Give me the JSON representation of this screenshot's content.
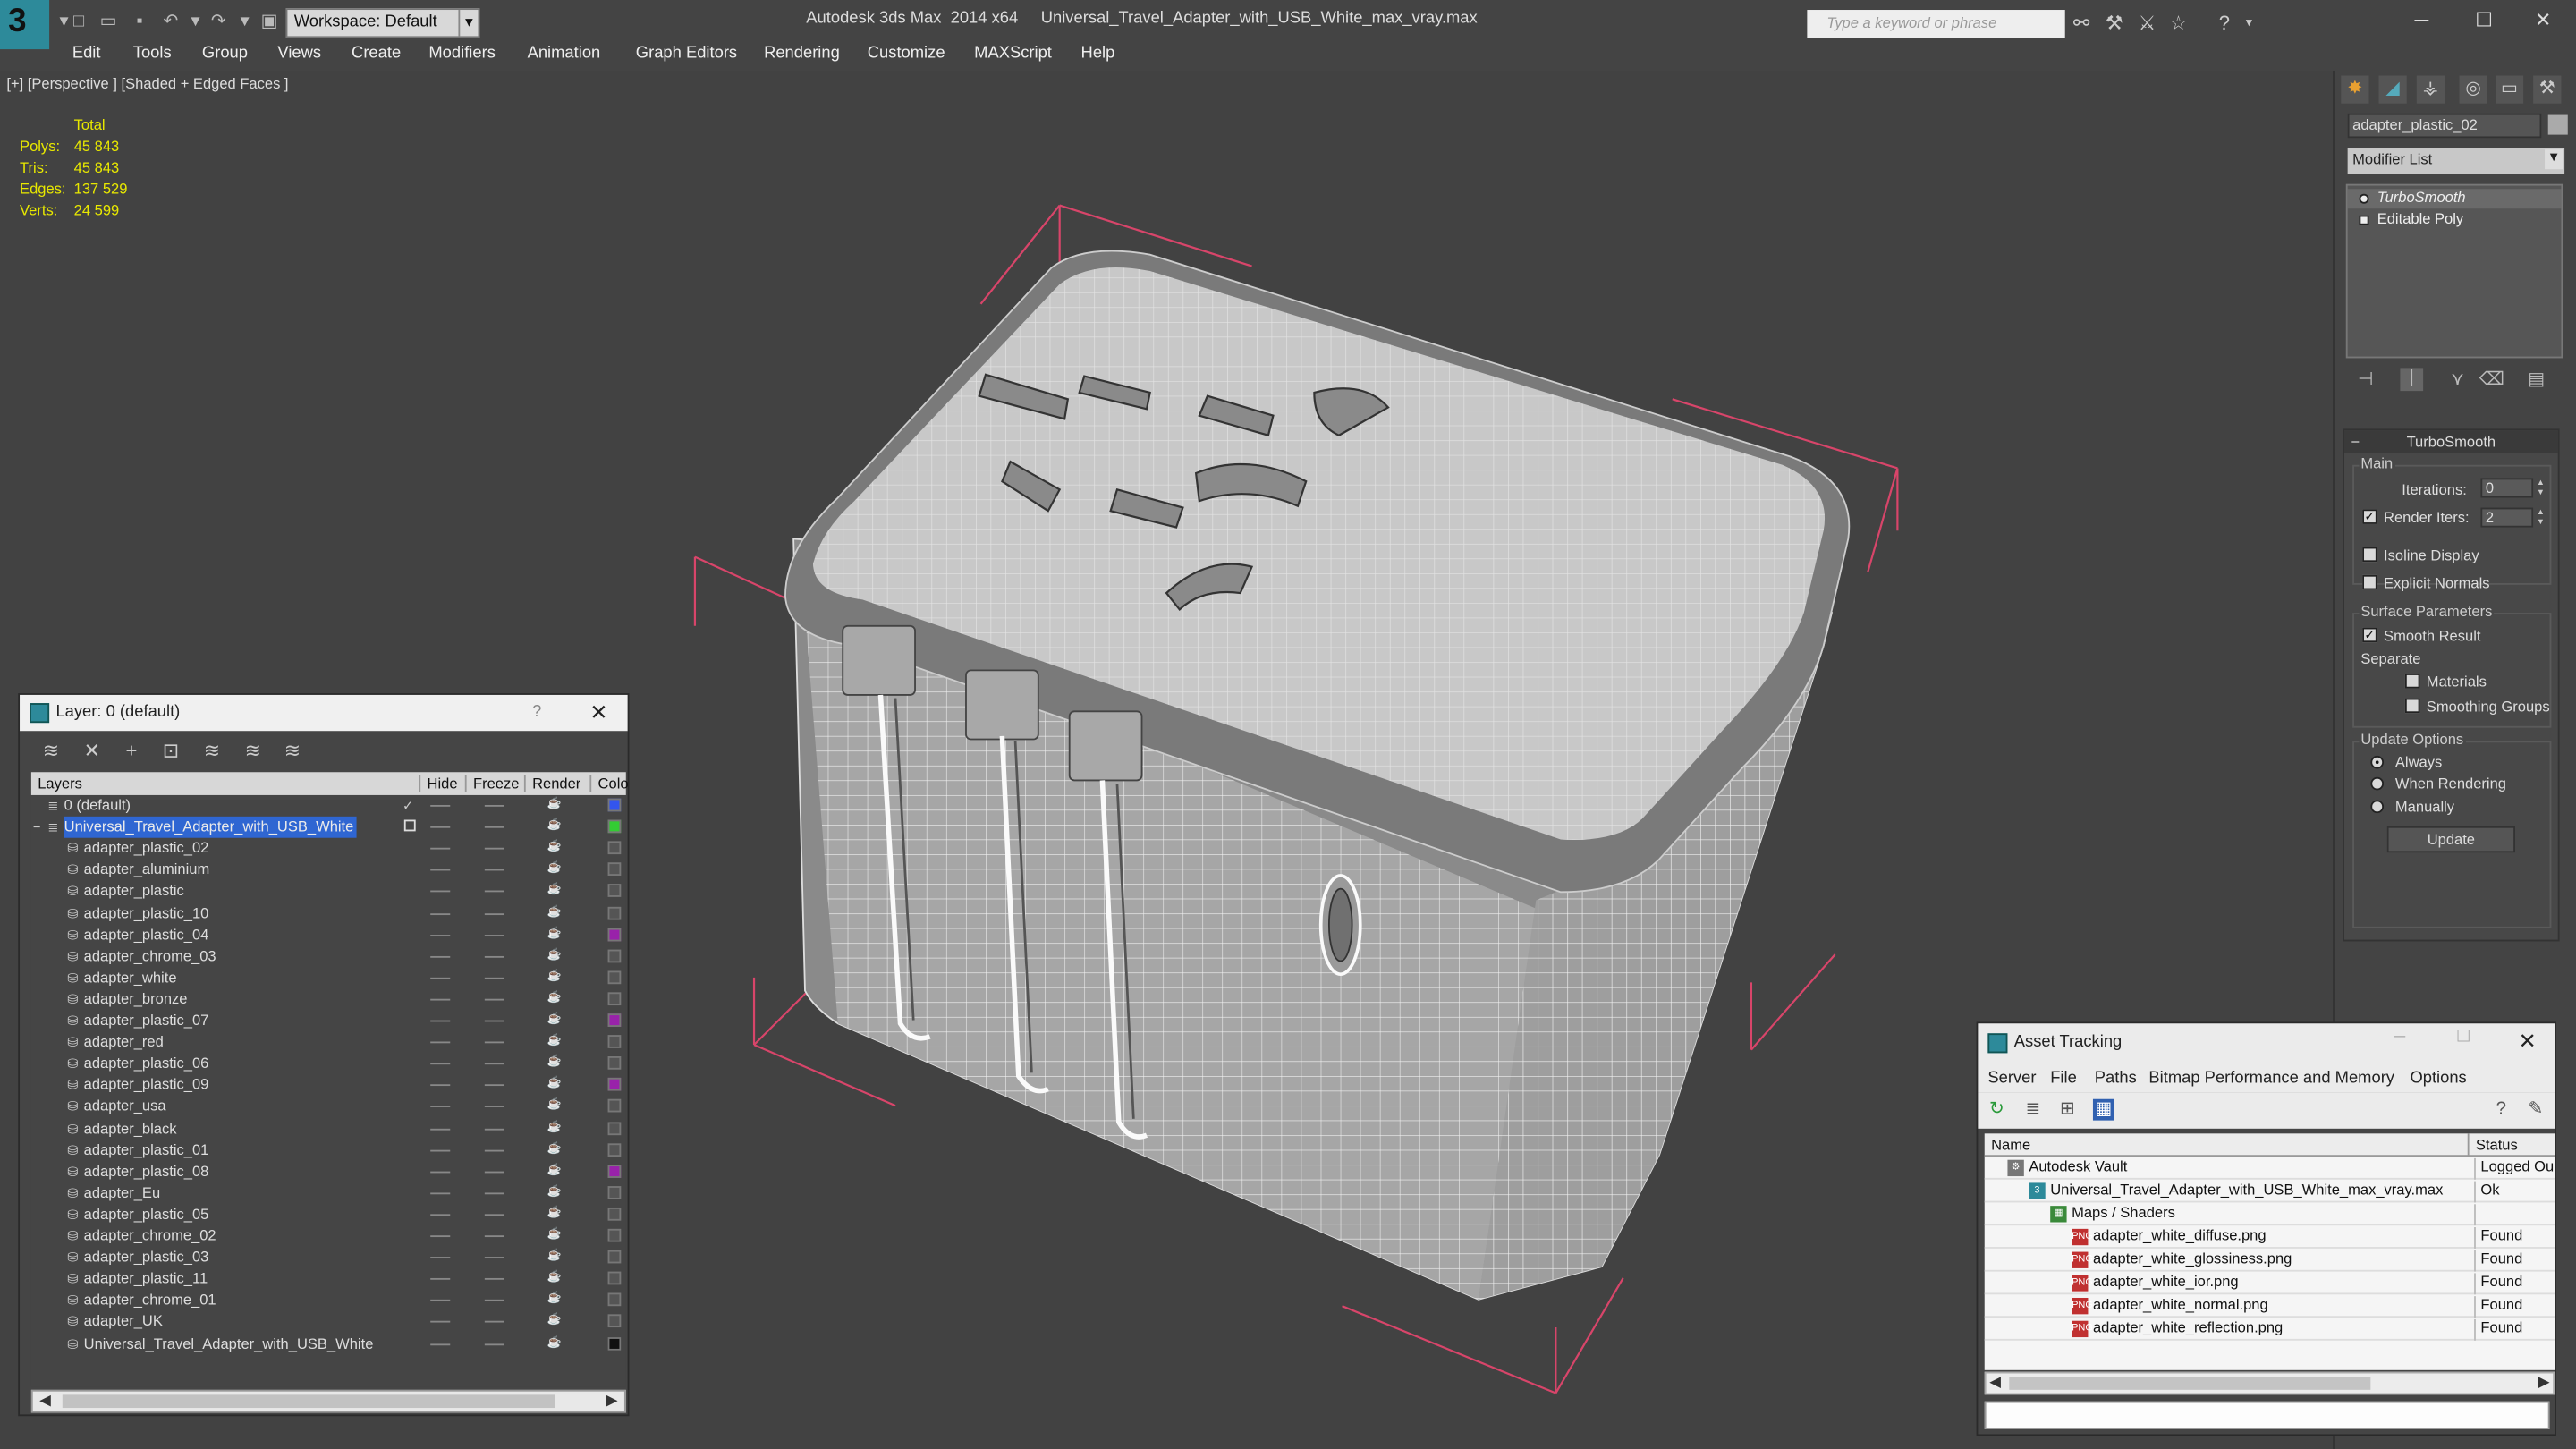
{
  "titlebar": {
    "app_name": "Autodesk 3ds Max  2014 x64",
    "file_name": "Universal_Travel_Adapter_with_USB_White_max_vray.max",
    "workspace": "Workspace: Default",
    "search_placeholder": "Type a keyword or phrase"
  },
  "menu": [
    "Edit",
    "Tools",
    "Group",
    "Views",
    "Create",
    "Modifiers",
    "Animation",
    "Graph Editors",
    "Rendering",
    "Customize",
    "MAXScript",
    "Help"
  ],
  "viewport": {
    "label": "[+] [Perspective ] [Shaded + Edged Faces ]",
    "stats_header": "Total",
    "stats": [
      {
        "label": "Polys:",
        "value": "45 843"
      },
      {
        "label": "Tris:",
        "value": "45 843"
      },
      {
        "label": "Edges:",
        "value": "137 529"
      },
      {
        "label": "Verts:",
        "value": "24 599"
      }
    ]
  },
  "command_panel": {
    "object_name": "adapter_plastic_02",
    "modifier_list": "Modifier List",
    "stack": [
      "TurboSmooth",
      "Editable Poly"
    ],
    "rollout_title": "TurboSmooth",
    "main_group": "Main",
    "iterations_label": "Iterations:",
    "iterations_value": "0",
    "render_iters_label": "Render Iters:",
    "render_iters_value": "2",
    "isoline_display": "Isoline Display",
    "explicit_normals": "Explicit Normals",
    "surface_params": "Surface Parameters",
    "smooth_result": "Smooth Result",
    "separate": "Separate",
    "materials": "Materials",
    "smoothing_groups": "Smoothing Groups",
    "update_options": "Update Options",
    "always": "Always",
    "when_rendering": "When Rendering",
    "manually": "Manually",
    "update_button": "Update"
  },
  "layer_window": {
    "title": "Layer: 0 (default)",
    "help": "?",
    "columns": [
      "Layers",
      "Hide",
      "Freeze",
      "Render",
      "Colo"
    ],
    "rows": [
      {
        "name": "0 (default)",
        "color": "#3355ee",
        "indent": 1,
        "type": "layer"
      },
      {
        "name": "Universal_Travel_Adapter_with_USB_White",
        "color": "#33cc33",
        "indent": 1,
        "type": "layer",
        "selected": true
      },
      {
        "name": "adapter_plastic_02",
        "color": "#555555",
        "indent": 2,
        "type": "obj"
      },
      {
        "name": "adapter_aluminium",
        "color": "#555555",
        "indent": 2,
        "type": "obj"
      },
      {
        "name": "adapter_plastic",
        "color": "#555555",
        "indent": 2,
        "type": "obj"
      },
      {
        "name": "adapter_plastic_10",
        "color": "#555555",
        "indent": 2,
        "type": "obj"
      },
      {
        "name": "adapter_plastic_04",
        "color": "#9922aa",
        "indent": 2,
        "type": "obj"
      },
      {
        "name": "adapter_chrome_03",
        "color": "#555555",
        "indent": 2,
        "type": "obj"
      },
      {
        "name": "adapter_white",
        "color": "#555555",
        "indent": 2,
        "type": "obj"
      },
      {
        "name": "adapter_bronze",
        "color": "#555555",
        "indent": 2,
        "type": "obj"
      },
      {
        "name": "adapter_plastic_07",
        "color": "#9922aa",
        "indent": 2,
        "type": "obj"
      },
      {
        "name": "adapter_red",
        "color": "#555555",
        "indent": 2,
        "type": "obj"
      },
      {
        "name": "adapter_plastic_06",
        "color": "#555555",
        "indent": 2,
        "type": "obj"
      },
      {
        "name": "adapter_plastic_09",
        "color": "#9922aa",
        "indent": 2,
        "type": "obj"
      },
      {
        "name": "adapter_usa",
        "color": "#555555",
        "indent": 2,
        "type": "obj"
      },
      {
        "name": "adapter_black",
        "color": "#555555",
        "indent": 2,
        "type": "obj"
      },
      {
        "name": "adapter_plastic_01",
        "color": "#555555",
        "indent": 2,
        "type": "obj"
      },
      {
        "name": "adapter_plastic_08",
        "color": "#9922aa",
        "indent": 2,
        "type": "obj"
      },
      {
        "name": "adapter_Eu",
        "color": "#555555",
        "indent": 2,
        "type": "obj"
      },
      {
        "name": "adapter_plastic_05",
        "color": "#555555",
        "indent": 2,
        "type": "obj"
      },
      {
        "name": "adapter_chrome_02",
        "color": "#555555",
        "indent": 2,
        "type": "obj"
      },
      {
        "name": "adapter_plastic_03",
        "color": "#555555",
        "indent": 2,
        "type": "obj"
      },
      {
        "name": "adapter_plastic_11",
        "color": "#555555",
        "indent": 2,
        "type": "obj"
      },
      {
        "name": "adapter_chrome_01",
        "color": "#555555",
        "indent": 2,
        "type": "obj"
      },
      {
        "name": "adapter_UK",
        "color": "#555555",
        "indent": 2,
        "type": "obj"
      },
      {
        "name": "Universal_Travel_Adapter_with_USB_White",
        "color": "#111111",
        "indent": 2,
        "type": "obj"
      }
    ]
  },
  "asset_window": {
    "title": "Asset Tracking",
    "menu": [
      "Server",
      "File",
      "Paths",
      "Bitmap Performance and Memory",
      "Options"
    ],
    "columns": [
      "Name",
      "Status"
    ],
    "rows": [
      {
        "name": "Autodesk Vault",
        "status": "Logged Ou",
        "indent": 0,
        "icon": "vault"
      },
      {
        "name": "Universal_Travel_Adapter_with_USB_White_max_vray.max",
        "status": "Ok",
        "indent": 1,
        "icon": "max"
      },
      {
        "name": "Maps / Shaders",
        "status": "",
        "indent": 2,
        "icon": "maps"
      },
      {
        "name": "adapter_white_diffuse.png",
        "status": "Found",
        "indent": 3,
        "icon": "png"
      },
      {
        "name": "adapter_white_glossiness.png",
        "status": "Found",
        "indent": 3,
        "icon": "png"
      },
      {
        "name": "adapter_white_ior.png",
        "status": "Found",
        "indent": 3,
        "icon": "png"
      },
      {
        "name": "adapter_white_normal.png",
        "status": "Found",
        "indent": 3,
        "icon": "png"
      },
      {
        "name": "adapter_white_reflection.png",
        "status": "Found",
        "indent": 3,
        "icon": "png"
      }
    ]
  }
}
